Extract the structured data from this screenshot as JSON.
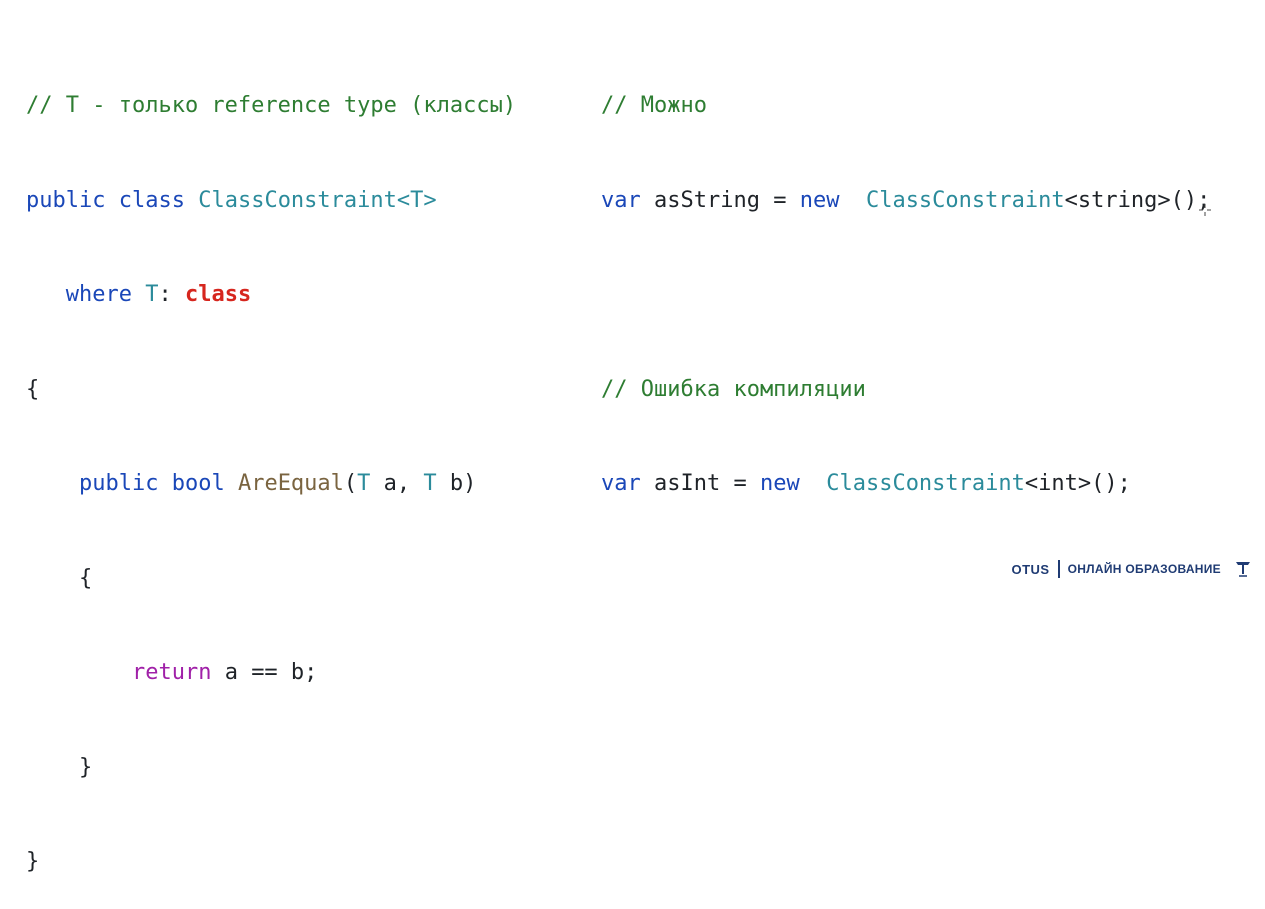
{
  "left_code": {
    "l1": "// T - только reference type (классы)",
    "l2": {
      "kw1": "public",
      "kw2": "class",
      "type": "ClassConstraint",
      "generic": "<T>"
    },
    "l3": {
      "indent": "   ",
      "kw": "where",
      "type": "T",
      "colon": ": ",
      "constraint": "class"
    },
    "l4": "{",
    "l5": {
      "indent": "    ",
      "kw1": "public",
      "kw2": "bool",
      "func": "AreEqual",
      "p_open": "(",
      "t1": "T",
      "a": " a, ",
      "t2": "T",
      "b": " b)"
    },
    "l6": "    {",
    "l7": {
      "indent": "        ",
      "kw": "return",
      "expr": " a == b;"
    },
    "l8": "    }",
    "l9": "}"
  },
  "right_code": {
    "c1": "// Можно",
    "l2": {
      "kw": "var",
      "name": " asString = ",
      "new": "new",
      "gap": "  ",
      "type": "ClassConstraint",
      "rest": "<string>();"
    },
    "c2": "// Ошибка компиляции",
    "l4": {
      "kw": "var",
      "name": " asInt = ",
      "new": "new",
      "gap": "  ",
      "type": "ClassConstraint",
      "rest": "<int>();"
    }
  },
  "footer": {
    "brand": "OTUS",
    "tagline": "ОНЛАЙН ОБРАЗОВАНИЕ",
    "logo_icon": "otus-logo-icon"
  },
  "colors": {
    "comment": "#2e7d32",
    "keyword": "#1a47b8",
    "control": "#a020a8",
    "type": "#2b8b9b",
    "function": "#7a6440",
    "highlight": "#d6261e"
  }
}
